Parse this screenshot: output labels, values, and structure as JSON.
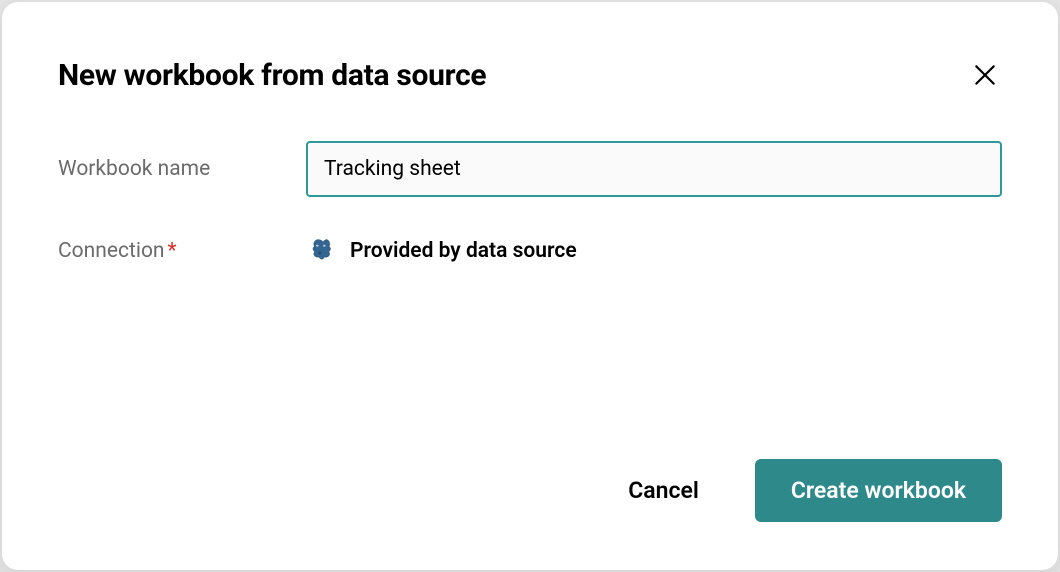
{
  "modal": {
    "title": "New workbook from data source",
    "form": {
      "workbook_name": {
        "label": "Workbook name",
        "value": "Tracking sheet"
      },
      "connection": {
        "label": "Connection",
        "required": true,
        "icon": "postgresql-icon",
        "value": "Provided by data source"
      }
    },
    "actions": {
      "cancel": "Cancel",
      "create": "Create workbook"
    }
  }
}
